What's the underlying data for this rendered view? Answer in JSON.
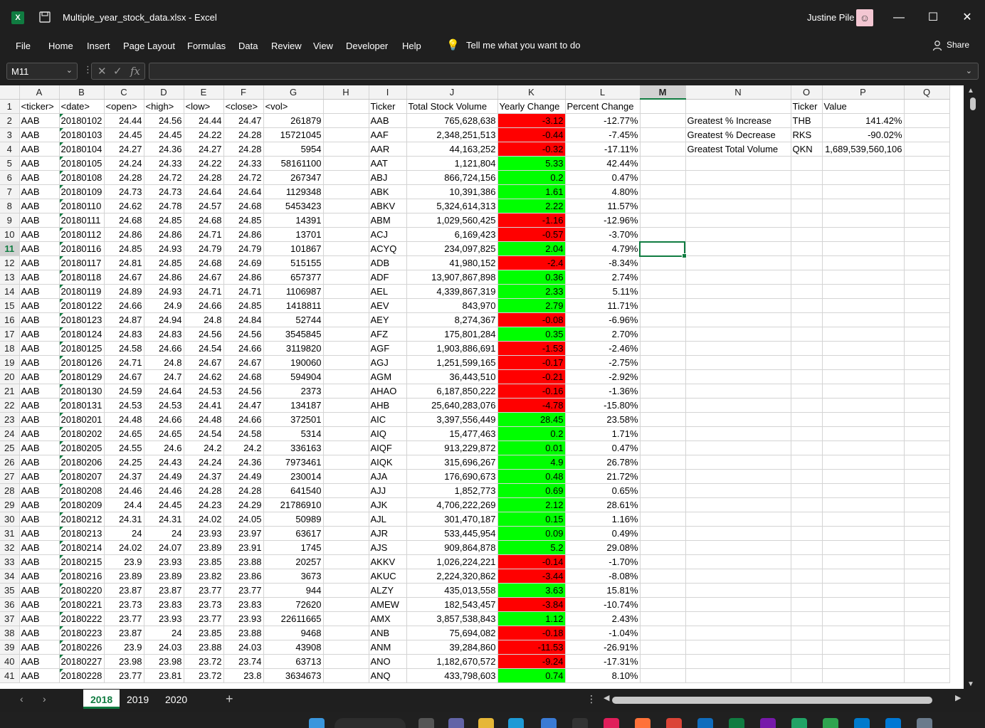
{
  "window": {
    "title": "Multiple_year_stock_data.xlsx  -  Excel",
    "user": "Justine Pile",
    "minimize": "—",
    "maximize": "☐",
    "close": "✕"
  },
  "menu": {
    "items": [
      "File",
      "Home",
      "Insert",
      "Page Layout",
      "Formulas",
      "Data",
      "Review",
      "View",
      "Developer",
      "Help"
    ],
    "tell_me": "Tell me what you want to do",
    "share": "Share"
  },
  "formula_bar": {
    "name_box": "M11",
    "formula": ""
  },
  "columns": [
    "A",
    "B",
    "C",
    "D",
    "E",
    "F",
    "G",
    "H",
    "I",
    "J",
    "K",
    "L",
    "M",
    "N",
    "O",
    "P",
    "Q"
  ],
  "selected_cell": {
    "column": "M",
    "row": 11
  },
  "header_row": [
    "<ticker>",
    "<date>",
    "<open>",
    "<high>",
    "<low>",
    "<close>",
    "<vol>",
    "",
    "Ticker",
    "Total Stock Volume",
    "Yearly Change",
    "Percent Change",
    "",
    "",
    "Ticker",
    "Value",
    ""
  ],
  "rows": [
    [
      "AAB",
      "20180102",
      "24.44",
      "24.56",
      "24.44",
      "24.47",
      "261879",
      "",
      "AAB",
      "765,628,638",
      "-3.12",
      "-12.77%",
      "",
      "Greatest % Increase",
      "THB",
      "141.42%",
      ""
    ],
    [
      "AAB",
      "20180103",
      "24.45",
      "24.45",
      "24.22",
      "24.28",
      "15721045",
      "",
      "AAF",
      "2,348,251,513",
      "-0.44",
      "-7.45%",
      "",
      "Greatest % Decrease",
      "RKS",
      "-90.02%",
      ""
    ],
    [
      "AAB",
      "20180104",
      "24.27",
      "24.36",
      "24.27",
      "24.28",
      "5954",
      "",
      "AAR",
      "44,163,252",
      "-0.32",
      "-17.11%",
      "",
      "Greatest Total Volume",
      "QKN",
      "1,689,539,560,106",
      ""
    ],
    [
      "AAB",
      "20180105",
      "24.24",
      "24.33",
      "24.22",
      "24.33",
      "58161100",
      "",
      "AAT",
      "1,121,804",
      "5.33",
      "42.44%",
      "",
      "",
      "",
      "",
      ""
    ],
    [
      "AAB",
      "20180108",
      "24.28",
      "24.72",
      "24.28",
      "24.72",
      "267347",
      "",
      "ABJ",
      "866,724,156",
      "0.2",
      "0.47%",
      "",
      "",
      "",
      "",
      ""
    ],
    [
      "AAB",
      "20180109",
      "24.73",
      "24.73",
      "24.64",
      "24.64",
      "1129348",
      "",
      "ABK",
      "10,391,386",
      "1.61",
      "4.80%",
      "",
      "",
      "",
      "",
      ""
    ],
    [
      "AAB",
      "20180110",
      "24.62",
      "24.78",
      "24.57",
      "24.68",
      "5453423",
      "",
      "ABKV",
      "5,324,614,313",
      "2.22",
      "11.57%",
      "",
      "",
      "",
      "",
      ""
    ],
    [
      "AAB",
      "20180111",
      "24.68",
      "24.85",
      "24.68",
      "24.85",
      "14391",
      "",
      "ABM",
      "1,029,560,425",
      "-1.16",
      "-12.96%",
      "",
      "",
      "",
      "",
      ""
    ],
    [
      "AAB",
      "20180112",
      "24.86",
      "24.86",
      "24.71",
      "24.86",
      "13701",
      "",
      "ACJ",
      "6,169,423",
      "-0.57",
      "-3.70%",
      "",
      "",
      "",
      "",
      ""
    ],
    [
      "AAB",
      "20180116",
      "24.85",
      "24.93",
      "24.79",
      "24.79",
      "101867",
      "",
      "ACYQ",
      "234,097,825",
      "2.04",
      "4.79%",
      "",
      "",
      "",
      "",
      ""
    ],
    [
      "AAB",
      "20180117",
      "24.81",
      "24.85",
      "24.68",
      "24.69",
      "515155",
      "",
      "ADB",
      "41,980,152",
      "-2.4",
      "-8.34%",
      "",
      "",
      "",
      "",
      ""
    ],
    [
      "AAB",
      "20180118",
      "24.67",
      "24.86",
      "24.67",
      "24.86",
      "657377",
      "",
      "ADF",
      "13,907,867,898",
      "0.36",
      "2.74%",
      "",
      "",
      "",
      "",
      ""
    ],
    [
      "AAB",
      "20180119",
      "24.89",
      "24.93",
      "24.71",
      "24.71",
      "1106987",
      "",
      "AEL",
      "4,339,867,319",
      "2.33",
      "5.11%",
      "",
      "",
      "",
      "",
      ""
    ],
    [
      "AAB",
      "20180122",
      "24.66",
      "24.9",
      "24.66",
      "24.85",
      "1418811",
      "",
      "AEV",
      "843,970",
      "2.79",
      "11.71%",
      "",
      "",
      "",
      "",
      ""
    ],
    [
      "AAB",
      "20180123",
      "24.87",
      "24.94",
      "24.8",
      "24.84",
      "52744",
      "",
      "AEY",
      "8,274,367",
      "-0.08",
      "-6.96%",
      "",
      "",
      "",
      "",
      ""
    ],
    [
      "AAB",
      "20180124",
      "24.83",
      "24.83",
      "24.56",
      "24.56",
      "3545845",
      "",
      "AFZ",
      "175,801,284",
      "0.35",
      "2.70%",
      "",
      "",
      "",
      "",
      ""
    ],
    [
      "AAB",
      "20180125",
      "24.58",
      "24.66",
      "24.54",
      "24.66",
      "3119820",
      "",
      "AGF",
      "1,903,886,691",
      "-1.53",
      "-2.46%",
      "",
      "",
      "",
      "",
      ""
    ],
    [
      "AAB",
      "20180126",
      "24.71",
      "24.8",
      "24.67",
      "24.67",
      "190060",
      "",
      "AGJ",
      "1,251,599,165",
      "-0.17",
      "-2.75%",
      "",
      "",
      "",
      "",
      ""
    ],
    [
      "AAB",
      "20180129",
      "24.67",
      "24.7",
      "24.62",
      "24.68",
      "594904",
      "",
      "AGM",
      "36,443,510",
      "-0.21",
      "-2.92%",
      "",
      "",
      "",
      "",
      ""
    ],
    [
      "AAB",
      "20180130",
      "24.59",
      "24.64",
      "24.53",
      "24.56",
      "2373",
      "",
      "AHAO",
      "6,187,850,222",
      "-0.16",
      "-1.36%",
      "",
      "",
      "",
      "",
      ""
    ],
    [
      "AAB",
      "20180131",
      "24.53",
      "24.53",
      "24.41",
      "24.47",
      "134187",
      "",
      "AHB",
      "25,640,283,076",
      "-4.78",
      "-15.80%",
      "",
      "",
      "",
      "",
      ""
    ],
    [
      "AAB",
      "20180201",
      "24.48",
      "24.66",
      "24.48",
      "24.66",
      "372501",
      "",
      "AIC",
      "3,397,556,449",
      "28.45",
      "23.58%",
      "",
      "",
      "",
      "",
      ""
    ],
    [
      "AAB",
      "20180202",
      "24.65",
      "24.65",
      "24.54",
      "24.58",
      "5314",
      "",
      "AIQ",
      "15,477,463",
      "0.2",
      "1.71%",
      "",
      "",
      "",
      "",
      ""
    ],
    [
      "AAB",
      "20180205",
      "24.55",
      "24.6",
      "24.2",
      "24.2",
      "336163",
      "",
      "AIQF",
      "913,229,872",
      "0.01",
      "0.47%",
      "",
      "",
      "",
      "",
      ""
    ],
    [
      "AAB",
      "20180206",
      "24.25",
      "24.43",
      "24.24",
      "24.36",
      "7973461",
      "",
      "AIQK",
      "315,696,267",
      "4.9",
      "26.78%",
      "",
      "",
      "",
      "",
      ""
    ],
    [
      "AAB",
      "20180207",
      "24.37",
      "24.49",
      "24.37",
      "24.49",
      "230014",
      "",
      "AJA",
      "176,690,673",
      "0.48",
      "21.72%",
      "",
      "",
      "",
      "",
      ""
    ],
    [
      "AAB",
      "20180208",
      "24.46",
      "24.46",
      "24.28",
      "24.28",
      "641540",
      "",
      "AJJ",
      "1,852,773",
      "0.69",
      "0.65%",
      "",
      "",
      "",
      "",
      ""
    ],
    [
      "AAB",
      "20180209",
      "24.4",
      "24.45",
      "24.23",
      "24.29",
      "21786910",
      "",
      "AJK",
      "4,706,222,269",
      "2.12",
      "28.61%",
      "",
      "",
      "",
      "",
      ""
    ],
    [
      "AAB",
      "20180212",
      "24.31",
      "24.31",
      "24.02",
      "24.05",
      "50989",
      "",
      "AJL",
      "301,470,187",
      "0.15",
      "1.16%",
      "",
      "",
      "",
      "",
      ""
    ],
    [
      "AAB",
      "20180213",
      "24",
      "24",
      "23.93",
      "23.97",
      "63617",
      "",
      "AJR",
      "533,445,954",
      "0.09",
      "0.49%",
      "",
      "",
      "",
      "",
      ""
    ],
    [
      "AAB",
      "20180214",
      "24.02",
      "24.07",
      "23.89",
      "23.91",
      "1745",
      "",
      "AJS",
      "909,864,878",
      "5.2",
      "29.08%",
      "",
      "",
      "",
      "",
      ""
    ],
    [
      "AAB",
      "20180215",
      "23.9",
      "23.93",
      "23.85",
      "23.88",
      "20257",
      "",
      "AKKV",
      "1,026,224,221",
      "-0.14",
      "-1.70%",
      "",
      "",
      "",
      "",
      ""
    ],
    [
      "AAB",
      "20180216",
      "23.89",
      "23.89",
      "23.82",
      "23.86",
      "3673",
      "",
      "AKUC",
      "2,224,320,862",
      "-3.44",
      "-8.08%",
      "",
      "",
      "",
      "",
      ""
    ],
    [
      "AAB",
      "20180220",
      "23.87",
      "23.87",
      "23.77",
      "23.77",
      "944",
      "",
      "ALZY",
      "435,013,558",
      "3.63",
      "15.81%",
      "",
      "",
      "",
      "",
      ""
    ],
    [
      "AAB",
      "20180221",
      "23.73",
      "23.83",
      "23.73",
      "23.83",
      "72620",
      "",
      "AMEW",
      "182,543,457",
      "-3.84",
      "-10.74%",
      "",
      "",
      "",
      "",
      ""
    ],
    [
      "AAB",
      "20180222",
      "23.77",
      "23.93",
      "23.77",
      "23.93",
      "22611665",
      "",
      "AMX",
      "3,857,538,843",
      "1.12",
      "2.43%",
      "",
      "",
      "",
      "",
      ""
    ],
    [
      "AAB",
      "20180223",
      "23.87",
      "24",
      "23.85",
      "23.88",
      "9468",
      "",
      "ANB",
      "75,694,082",
      "-0.18",
      "-1.04%",
      "",
      "",
      "",
      "",
      ""
    ],
    [
      "AAB",
      "20180226",
      "23.9",
      "24.03",
      "23.88",
      "24.03",
      "43908",
      "",
      "ANM",
      "39,284,860",
      "-11.53",
      "-26.91%",
      "",
      "",
      "",
      "",
      ""
    ],
    [
      "AAB",
      "20180227",
      "23.98",
      "23.98",
      "23.72",
      "23.74",
      "63713",
      "",
      "ANO",
      "1,182,670,572",
      "-9.24",
      "-17.31%",
      "",
      "",
      "",
      "",
      ""
    ],
    [
      "AAB",
      "20180228",
      "23.77",
      "23.81",
      "23.72",
      "23.8",
      "3634673",
      "",
      "ANQ",
      "433,798,603",
      "0.74",
      "8.10%",
      "",
      "",
      "",
      "",
      ""
    ]
  ],
  "sheet_tabs": [
    "2018",
    "2019",
    "2020"
  ],
  "active_tab": "2018",
  "colors": {
    "negative_fill": "#ff0000",
    "positive_fill": "#00ff00",
    "accent": "#107c41"
  }
}
